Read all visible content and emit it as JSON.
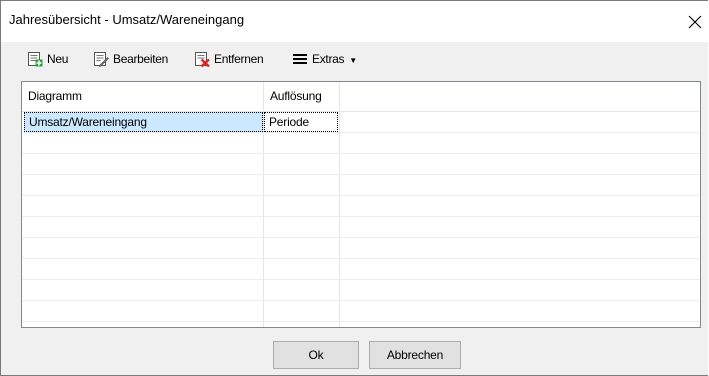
{
  "window": {
    "title": "Jahresübersicht - Umsatz/Wareneingang",
    "close_glyph": "✕"
  },
  "toolbar": {
    "new_label": "Neu",
    "edit_label": "Bearbeiten",
    "delete_label": "Entfernen",
    "extras_label": "Extras",
    "extras_dropdown_glyph": "▼",
    "extras_icon_glyph": "☰"
  },
  "grid": {
    "columns": [
      "Diagramm",
      "Auflösung"
    ],
    "rows": [
      {
        "diagramm": "Umsatz/Wareneingang",
        "aufloesung": "Periode",
        "selected": true
      }
    ]
  },
  "dialog": {
    "ok_label": "Ok",
    "cancel_label": "Abbrechen"
  },
  "colors": {
    "selection": "#cce8ff",
    "window_bg": "#f0f0f0",
    "border": "#828790"
  }
}
